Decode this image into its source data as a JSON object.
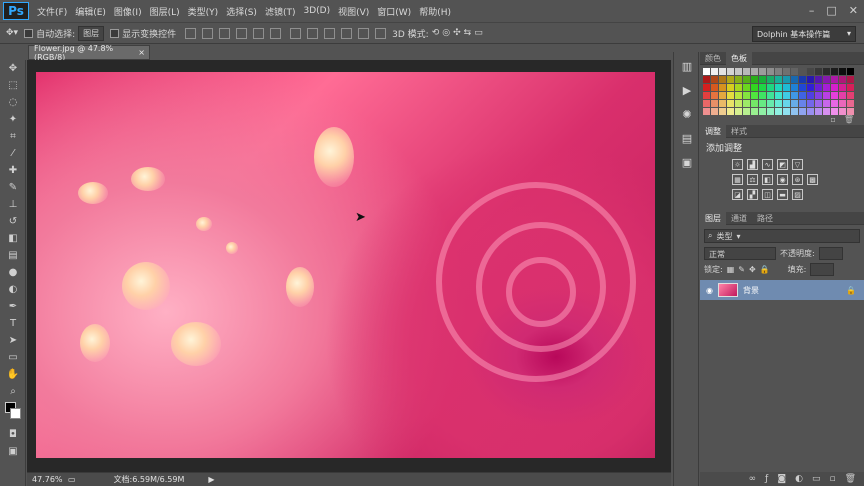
{
  "app": {
    "logo": "Ps"
  },
  "menu": [
    "文件(F)",
    "编辑(E)",
    "图像(I)",
    "图层(L)",
    "类型(Y)",
    "选择(S)",
    "滤镜(T)",
    "3D(D)",
    "视图(V)",
    "窗口(W)",
    "帮助(H)"
  ],
  "window_controls": {
    "minimize": "–",
    "restore": "□",
    "close": "✕"
  },
  "options": {
    "auto_select_label": "自动选择:",
    "auto_select_value": "图层",
    "show_transform_label": "显示变换控件",
    "mode_3d_label": "3D 模式:",
    "workspace": "Dolphin 基本操作篇"
  },
  "document": {
    "tab_title": "Flower.jpg @ 47.8%(RGB/8)",
    "close": "×"
  },
  "status": {
    "zoom": "47.76%",
    "doc_size": "文档:6.59M/6.59M",
    "arrow": "▶"
  },
  "panels": {
    "swatch_tabs": [
      "颜色",
      "色板"
    ],
    "adjust_tabs": [
      "调整",
      "样式"
    ],
    "adjust_title": "添加调整",
    "layer_tabs": [
      "图层",
      "通道",
      "路径"
    ],
    "filter_kind": "类型",
    "blend_mode": "正常",
    "opacity_label": "不透明度:",
    "fill_label": "填充:",
    "lock_label": "锁定:",
    "layer_name": "背景"
  },
  "colors": {
    "accent": "#31a8ff",
    "layer_selected": "#6f8bb0",
    "rose": "#d92f6c"
  }
}
